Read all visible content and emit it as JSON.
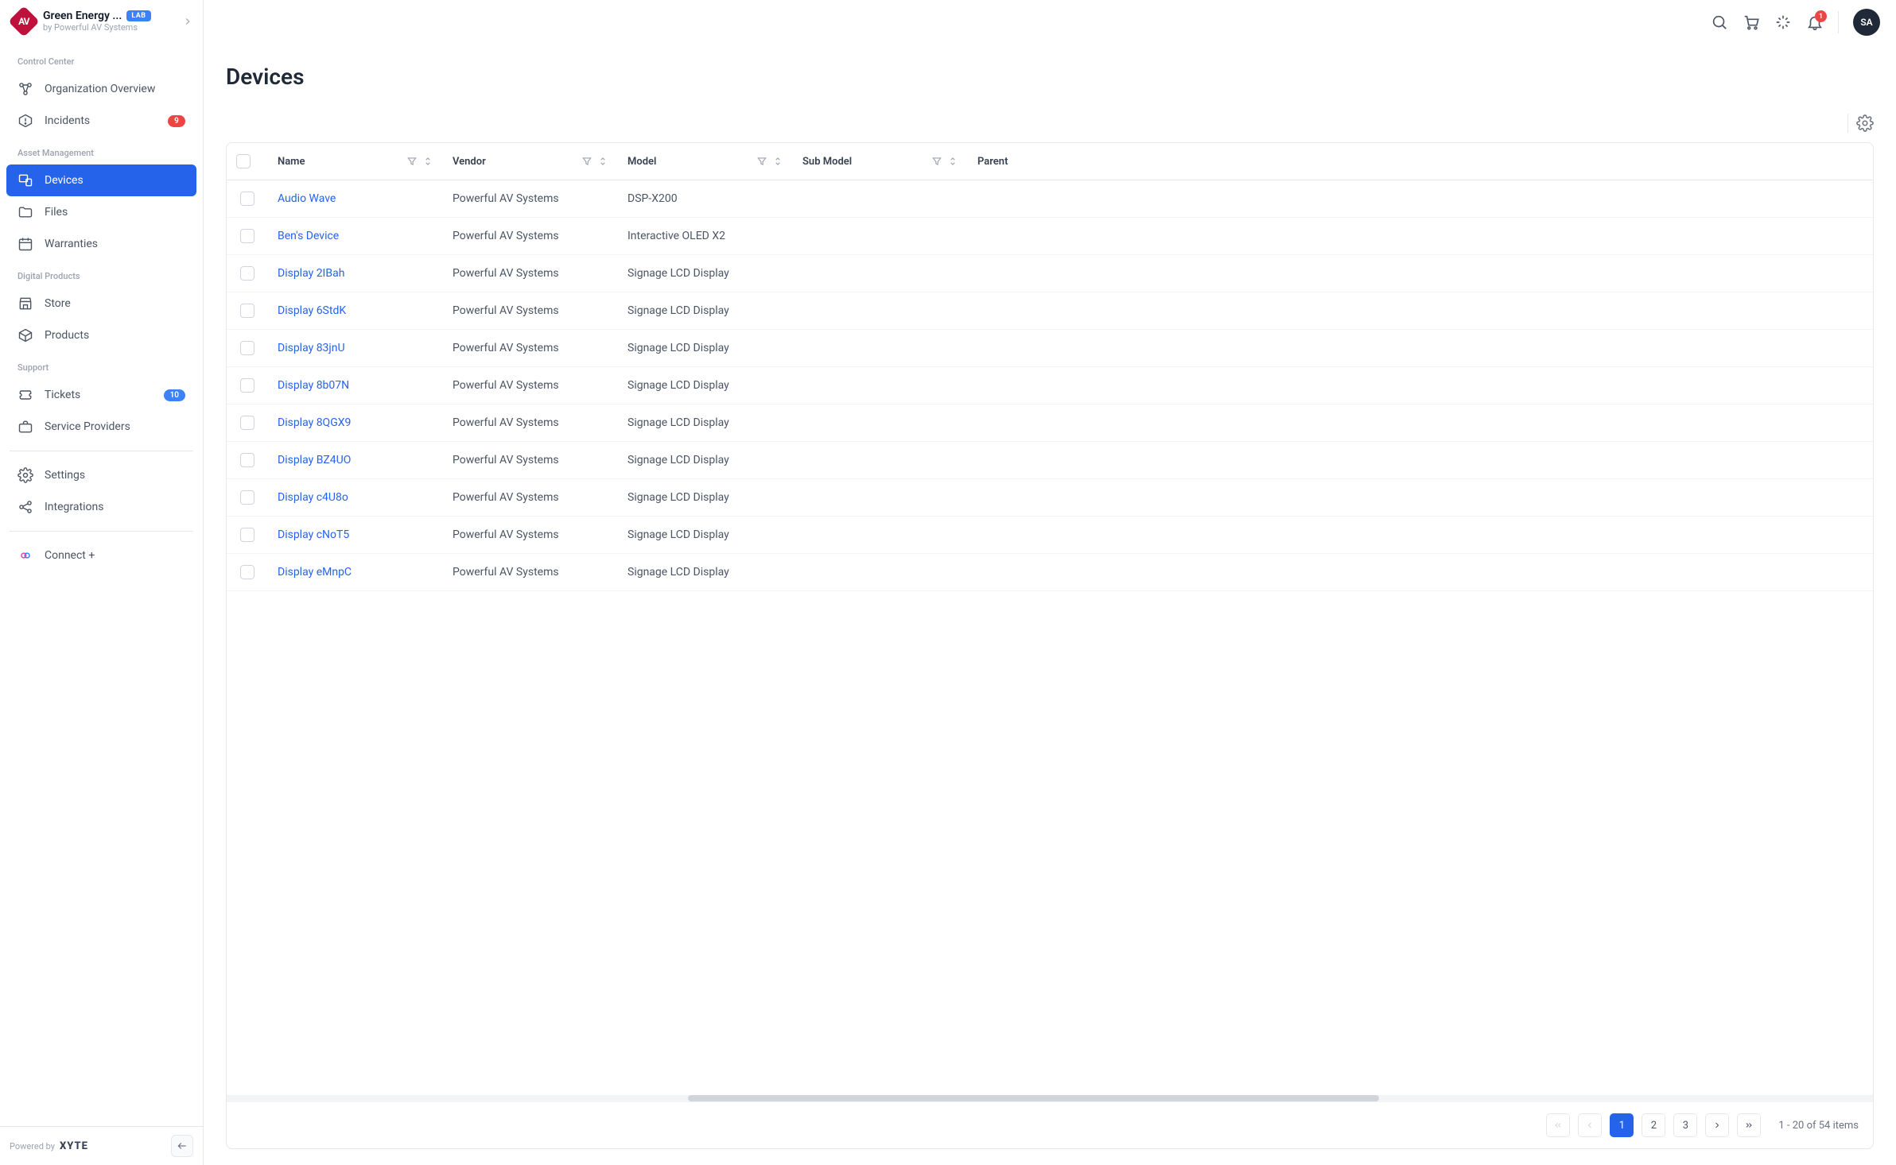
{
  "header": {
    "org_name": "Green Energy ...",
    "lab_label": "LAB",
    "org_sub": "by Powerful AV Systems",
    "avatar": "SA",
    "notif_count": "1"
  },
  "sidebar": {
    "sections": {
      "control": "Control Center",
      "asset": "Asset Management",
      "digital": "Digital Products",
      "support": "Support"
    },
    "items": {
      "overview": "Organization Overview",
      "incidents": "Incidents",
      "incidents_badge": "9",
      "devices": "Devices",
      "files": "Files",
      "warranties": "Warranties",
      "store": "Store",
      "products": "Products",
      "tickets": "Tickets",
      "tickets_badge": "10",
      "providers": "Service Providers",
      "settings": "Settings",
      "integrations": "Integrations",
      "connect": "Connect +"
    },
    "powered": "Powered by",
    "brand": "XYTE"
  },
  "page": {
    "title": "Devices"
  },
  "table": {
    "columns": {
      "name": "Name",
      "vendor": "Vendor",
      "model": "Model",
      "submodel": "Sub Model",
      "parent": "Parent"
    },
    "rows": [
      {
        "name": "Audio Wave",
        "vendor": "Powerful AV Systems",
        "model": "DSP-X200",
        "submodel": "",
        "parent": ""
      },
      {
        "name": "Ben's Device",
        "vendor": "Powerful AV Systems",
        "model": "Interactive OLED X2",
        "submodel": "",
        "parent": ""
      },
      {
        "name": "Display 2IBah",
        "vendor": "Powerful AV Systems",
        "model": "Signage LCD Display",
        "submodel": "",
        "parent": ""
      },
      {
        "name": "Display 6StdK",
        "vendor": "Powerful AV Systems",
        "model": "Signage LCD Display",
        "submodel": "",
        "parent": ""
      },
      {
        "name": "Display 83jnU",
        "vendor": "Powerful AV Systems",
        "model": "Signage LCD Display",
        "submodel": "",
        "parent": ""
      },
      {
        "name": "Display 8b07N",
        "vendor": "Powerful AV Systems",
        "model": "Signage LCD Display",
        "submodel": "",
        "parent": ""
      },
      {
        "name": "Display 8QGX9",
        "vendor": "Powerful AV Systems",
        "model": "Signage LCD Display",
        "submodel": "",
        "parent": ""
      },
      {
        "name": "Display BZ4UO",
        "vendor": "Powerful AV Systems",
        "model": "Signage LCD Display",
        "submodel": "",
        "parent": ""
      },
      {
        "name": "Display c4U8o",
        "vendor": "Powerful AV Systems",
        "model": "Signage LCD Display",
        "submodel": "",
        "parent": ""
      },
      {
        "name": "Display cNoT5",
        "vendor": "Powerful AV Systems",
        "model": "Signage LCD Display",
        "submodel": "",
        "parent": ""
      },
      {
        "name": "Display eMnpC",
        "vendor": "Powerful AV Systems",
        "model": "Signage LCD Display",
        "submodel": "",
        "parent": ""
      }
    ]
  },
  "pager": {
    "p1": "1",
    "p2": "2",
    "p3": "3",
    "info": "1 - 20 of 54 items"
  }
}
